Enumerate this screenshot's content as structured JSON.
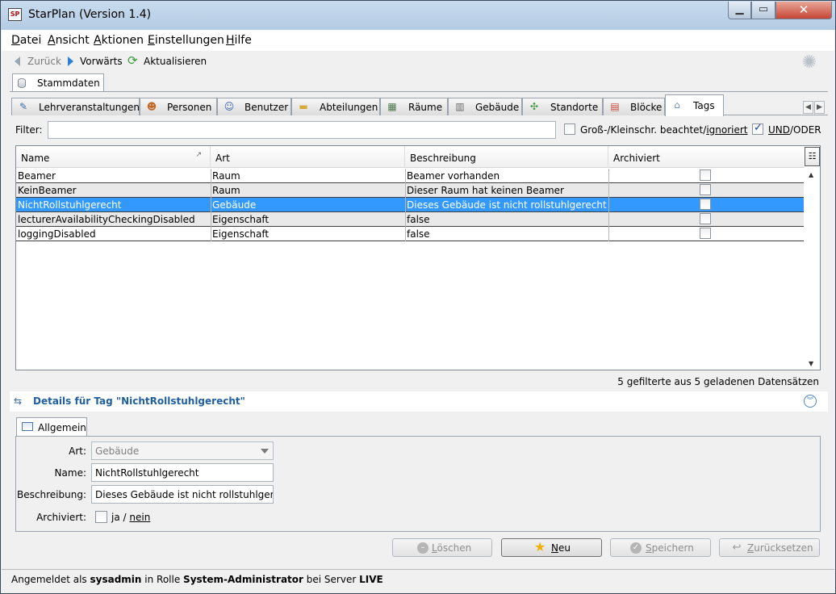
{
  "window": {
    "title": "StarPlan (Version 1.4)",
    "app_icon": "SP"
  },
  "menu": [
    "Datei",
    "Ansicht",
    "Aktionen",
    "Einstellungen",
    "Hilfe"
  ],
  "nav": {
    "back": "Zurück",
    "forward": "Vorwärts",
    "refresh": "Aktualisieren"
  },
  "top_tab": "Stammdaten",
  "tabs": [
    "Lehrveranstaltungen",
    "Personen",
    "Benutzer",
    "Abteilungen",
    "Räume",
    "Gebäude",
    "Standorte",
    "Blöcke",
    "Tags"
  ],
  "active_tab": "Tags",
  "filter": {
    "label": "Filter:",
    "value": "",
    "case_option": "Groß-/Kleinschr. beachtet/",
    "case_option_underlined": "ignoriert",
    "case_checked": false,
    "logic_option_underlined": "UND",
    "logic_option_rest": "/ODER",
    "logic_checked": true
  },
  "table": {
    "columns": [
      "Name",
      "Art",
      "Beschreibung",
      "Archiviert"
    ],
    "rows": [
      {
        "name": "Beamer",
        "art": "Raum",
        "beschreibung": "Beamer vorhanden",
        "archiviert": false
      },
      {
        "name": "KeinBeamer",
        "art": "Raum",
        "beschreibung": "Dieser Raum hat keinen Beamer",
        "archiviert": false
      },
      {
        "name": "NichtRollstuhlgerecht",
        "art": "Gebäude",
        "beschreibung": "Dieses Gebäude ist nicht rollstuhlgerecht",
        "archiviert": false
      },
      {
        "name": "lecturerAvailabilityCheckingDisabled",
        "art": "Eigenschaft",
        "beschreibung": "false",
        "archiviert": false
      },
      {
        "name": "loggingDisabled",
        "art": "Eigenschaft",
        "beschreibung": "false",
        "archiviert": false
      }
    ],
    "selected_row": 2
  },
  "count_text": "5 gefilterte aus 5 geladenen Datensätzen",
  "details": {
    "title": "Details für Tag \"NichtRollstuhlgerecht\"",
    "sub_tab": "Allgemein",
    "art_label": "Art:",
    "art_value": "Gebäude",
    "name_label": "Name:",
    "name_value": "NichtRollstuhlgerecht",
    "beschreibung_label": "Beschreibung:",
    "beschreibung_value": "Dieses Gebäude ist nicht rollstuhlgerec",
    "archiviert_label": "Archiviert:",
    "archiviert_ja": "ja /",
    "archiviert_nein": "nein",
    "archiviert_checked": false
  },
  "buttons": {
    "delete": "Löschen",
    "new": "Neu",
    "save": "Speichern",
    "reset": "Zurücksetzen"
  },
  "status": {
    "prefix": "Angemeldet als ",
    "user": "sysadmin",
    "mid": " in Rolle ",
    "role": "System-Administrator",
    "mid2": " bei Server ",
    "server": "LIVE"
  },
  "colors": {
    "selection": "#3399ff",
    "accent_title": "#1f5f9f"
  }
}
